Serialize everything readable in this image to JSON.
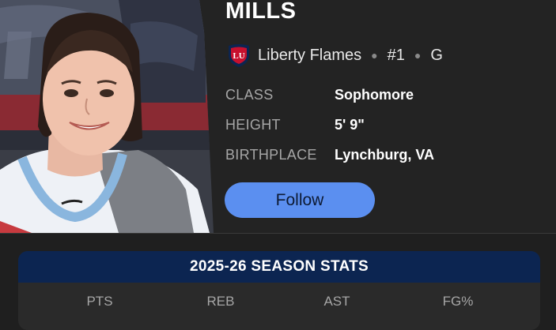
{
  "player": {
    "name": "MILLS",
    "team": "Liberty Flames",
    "number": "#1",
    "position": "G",
    "logo_text": "LU"
  },
  "info": [
    {
      "label": "CLASS",
      "value": "Sophomore"
    },
    {
      "label": "HEIGHT",
      "value": "5' 9\""
    },
    {
      "label": "BIRTHPLACE",
      "value": "Lynchburg, VA"
    }
  ],
  "follow_label": "Follow",
  "stats": {
    "title": "2025-26 SEASON STATS",
    "columns": [
      "PTS",
      "REB",
      "AST",
      "FG%"
    ]
  },
  "colors": {
    "background": "#1f1f1f",
    "follow_button": "#5b8ff0",
    "stats_header": "#0c2551",
    "label_gray": "#a6a6a6"
  }
}
